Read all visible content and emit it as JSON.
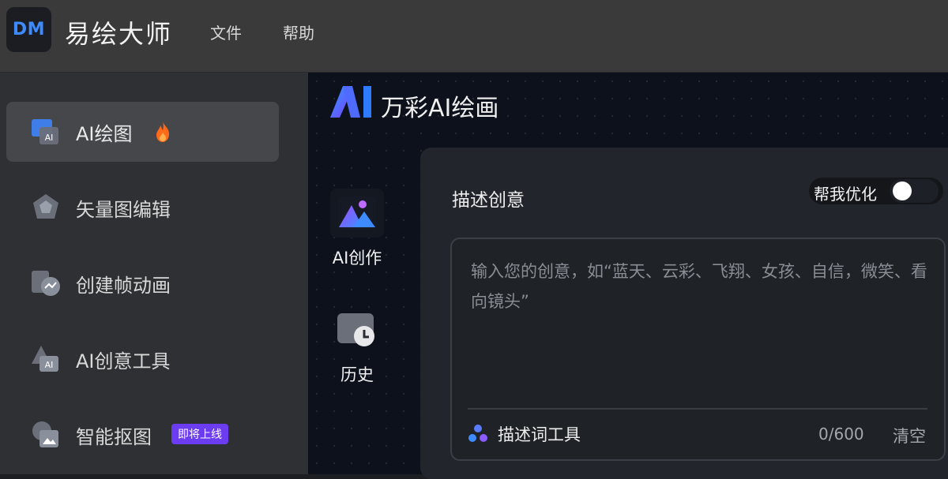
{
  "app": {
    "logo_text": "DM",
    "title": "易绘大师"
  },
  "menu": {
    "file": "文件",
    "help": "帮助"
  },
  "sidebar": {
    "items": [
      {
        "label": "AI绘图",
        "icon": "ai-image-icon",
        "active": true,
        "hot": true
      },
      {
        "label": "矢量图编辑",
        "icon": "vector-edit-icon"
      },
      {
        "label": "创建帧动画",
        "icon": "frame-animation-icon"
      },
      {
        "label": "AI创意工具",
        "icon": "ai-tools-icon"
      },
      {
        "label": "智能抠图",
        "icon": "smart-cutout-icon",
        "badge": "即将上线"
      }
    ]
  },
  "main": {
    "brand_title": "万彩AI绘画",
    "rail": [
      {
        "label": "AI创作",
        "icon": "ai-create-icon"
      },
      {
        "label": "历史",
        "icon": "history-icon"
      }
    ],
    "panel": {
      "title": "描述创意",
      "optimize_label": "帮我优化",
      "optimize_on": false,
      "prompt_value": "",
      "prompt_placeholder": "输入您的创意，如“蓝天、云彩、飞翔、女孩、自信，微笑、看向镜头”",
      "tools_label": "描述词工具",
      "counter": "0/600",
      "clear_label": "清空"
    }
  },
  "colors": {
    "accent_blue": "#3d8bff",
    "badge_purple": "#6b3cf0",
    "fire_orange": "#ff6a1a"
  }
}
